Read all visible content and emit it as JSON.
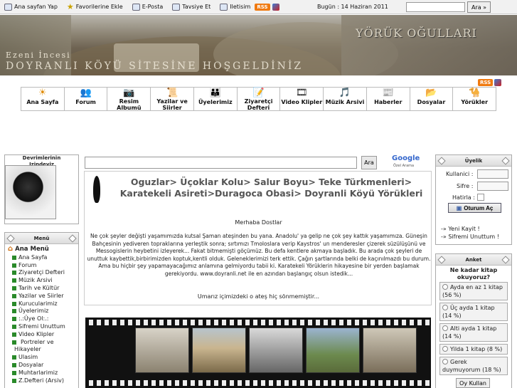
{
  "topbar": {
    "links": [
      "Ana sayfan Yap",
      "Favorilerine Ekle",
      "E-Posta",
      "Tavsiye Et",
      "Iletisim"
    ],
    "rss": "RSS",
    "date": "Bugün : 14 Haziran 2011",
    "search_value": "",
    "search_button": "Ara »"
  },
  "banner": {
    "title": "YÖRÜK OĞULLARI",
    "subtitle1": "Ezeni İncesi",
    "subtitle2": "DOYRANLI KÖYÜ SİTESİNE HOŞGELDİNİZ"
  },
  "nav": [
    {
      "label": "Ana Sayfa",
      "icon": "sun-icon",
      "glyph": "☀"
    },
    {
      "label": "Forum",
      "icon": "people-icon",
      "glyph": "👥"
    },
    {
      "label": "Resim Albumü",
      "icon": "camera-icon",
      "glyph": "📷"
    },
    {
      "label": "Yazilar ve Siirler",
      "icon": "scroll-icon",
      "glyph": "📜"
    },
    {
      "label": "Üyelerimiz",
      "icon": "users-icon",
      "glyph": "👪"
    },
    {
      "label": "Ziyaretçi Defteri",
      "icon": "guestbook-icon",
      "glyph": "📝"
    },
    {
      "label": "Video Klipler",
      "icon": "film-icon",
      "glyph": "🎞"
    },
    {
      "label": "Müzik Arsivi",
      "icon": "music-icon",
      "glyph": "🎵"
    },
    {
      "label": "Haberler",
      "icon": "news-icon",
      "glyph": "📰"
    },
    {
      "label": "Dosyalar",
      "icon": "folder-icon",
      "glyph": "📂"
    },
    {
      "label": "Yörükler",
      "icon": "camel-icon",
      "glyph": "🐪"
    }
  ],
  "left": {
    "ataturk_title": "Devrimlerinin Izindeyiz",
    "menu_title": "Menü",
    "menu_header": "Ana Menü",
    "menu_items": [
      "Ana Sayfa",
      "Forum",
      "Ziyaretçi Defteri",
      "Müzik Arsivi",
      "Tarih ve Kültür",
      "Yazilar ve Siirler",
      "Kurucularimiz",
      "Üyelerimiz",
      ":.:Üye Ol:.:",
      "Sifremi Unuttum",
      "Video Klipler",
      "Portreler ve Hikayeler",
      "Ulasim",
      "Dosyalar",
      "Muhtarlarimiz",
      "Z.Defteri (Arsiv)"
    ]
  },
  "main": {
    "search_value": "",
    "search_button": "Ara",
    "google_logo": "Google",
    "google_sub": "Özel Arama",
    "heading": "Oguzlar> Üçoklar Kolu> Salur Boyu> Teke Türkmenleri> Karatekeli Asireti>Duragocа Obasi> Doyranli Köyü Yörükleri",
    "greeting": "Merhaba Dostlar",
    "paragraph": "Ne çok şeyler değişti yaşamımızda kutsal Şaman ateşinden bu yana. Anadolu' ya gelip ne çok şey kattık yaşamımıza. Güneşin Bahçesinin yediveren topraklarına yerleştik sonra; sırtımızı Tmoloslara verip Kaystros' un menderesler çizerek süzülüşünü ve Messogislerin heybetini izleyerek... Fakat bitmemişti göçümüz. Bu defa kentlere akmaya başladık. Bu arada çok şeyleri de unuttuk kaybettik,birbirimizden koptuk,kentli olduk. Geleneklerimizi terk ettik. Çağın şartlarında belki de kaçınılmazdı bu durum. Ama bu hiçbir şey yapamayacağımız anlamına gelmiyordu tabii ki. Karatekeli Yörüklerin hikayesine bir yerden başlamak gerekiyordu. www.doyranli.net ile en azından başlangıç olsun istedik...",
    "closing": "Umarız içimizdeki o ateş hiç sönmemiştir..."
  },
  "right": {
    "member_title": "Üyelik",
    "user_label": "Kullanici :",
    "pass_label": "Sifre :",
    "remember_label": "Hatirla :",
    "login_button": "Oturum Aç",
    "new_account": "-» Yeni Kayit !",
    "forgot": "-» Sifremi Unuttum !",
    "poll_title": "Anket",
    "poll_question": "Ne kadar kitap okuyoruz?",
    "poll_options": [
      "Ayda en az 1 kitap (56 %)",
      "Üç ayda 1 kitap (14 %)",
      "Alti ayda 1 kitap (14 %)",
      "Yilda 1 kitap (8 %)",
      "Gerek duymuyorum (18 %)"
    ],
    "vote_button": "Oy Kullan"
  }
}
